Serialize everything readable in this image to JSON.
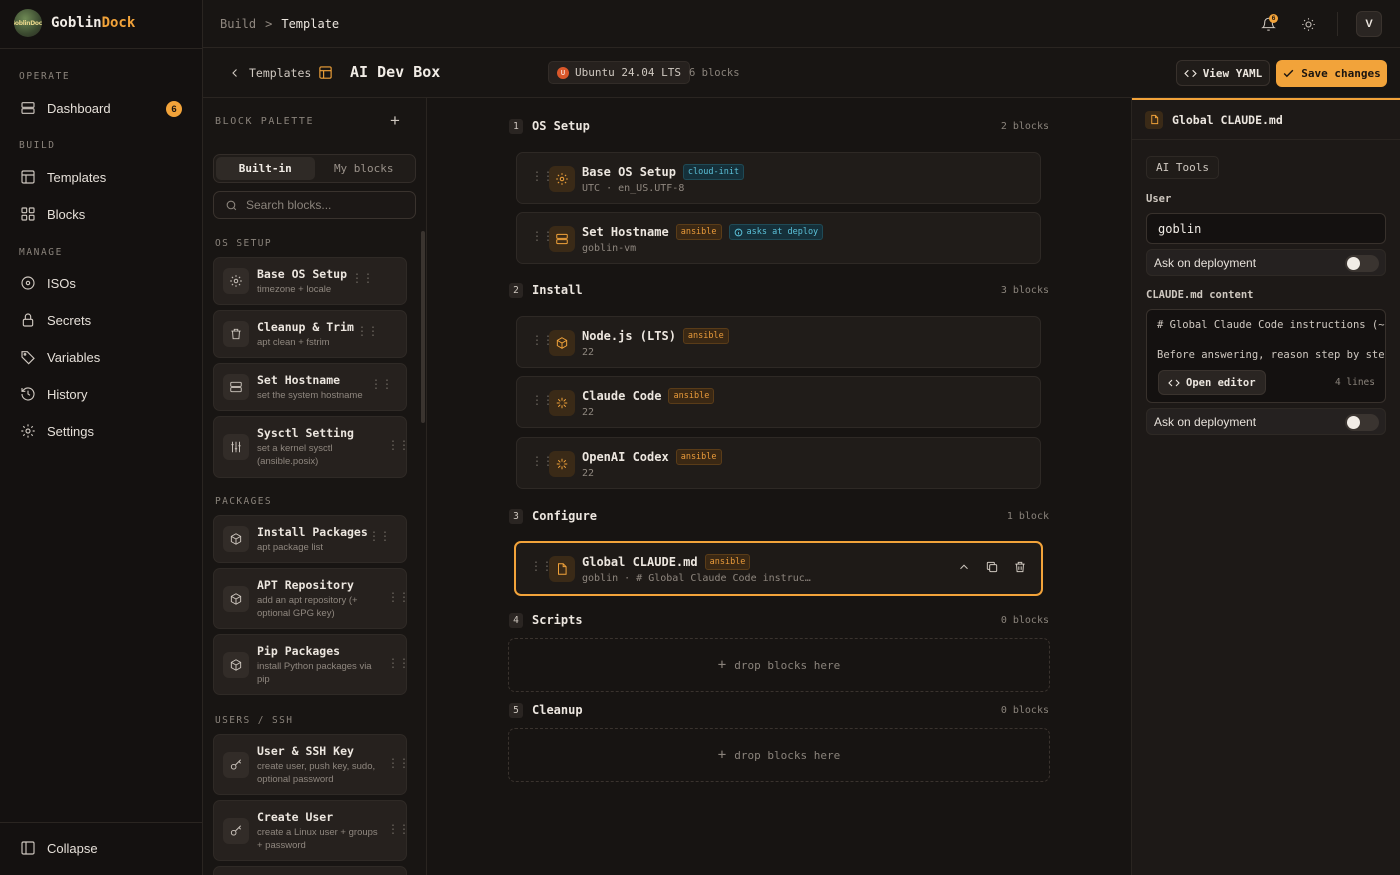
{
  "app": {
    "brand_part1": "Goblin",
    "brand_part2": "Dock",
    "logo_text": "GoblinDock"
  },
  "sidebar": {
    "sections": {
      "operate": "OPERATE",
      "build": "BUILD",
      "manage": "MANAGE"
    },
    "items": [
      {
        "label": "Dashboard",
        "icon": "server-icon",
        "badge": "6"
      },
      {
        "label": "Templates",
        "icon": "template-icon"
      },
      {
        "label": "Blocks",
        "icon": "grid-icon"
      },
      {
        "label": "ISOs",
        "icon": "disc-icon"
      },
      {
        "label": "Secrets",
        "icon": "lock-icon"
      },
      {
        "label": "Variables",
        "icon": "tag-icon"
      },
      {
        "label": "History",
        "icon": "history-icon"
      },
      {
        "label": "Settings",
        "icon": "gear-icon"
      }
    ],
    "collapse": "Collapse"
  },
  "topbar": {
    "breadcrumb": [
      "Build",
      "Template"
    ],
    "notifications": "6",
    "avatar": "V"
  },
  "titlebar": {
    "back": "Templates",
    "title": "AI Dev Box",
    "os": "Ubuntu 24.04 LTS",
    "os_badge": "U",
    "block_count": "6 blocks",
    "view_yaml": "View YAML",
    "save": "Save changes"
  },
  "palette": {
    "header": "BLOCK PALETTE",
    "tabs": [
      "Built-in",
      "My blocks"
    ],
    "search_placeholder": "Search blocks...",
    "categories": [
      "OS SETUP",
      "PACKAGES",
      "USERS / SSH"
    ],
    "cards": [
      {
        "name": "Base OS Setup",
        "desc": [
          "timezone + locale"
        ],
        "icon": "gear-icon"
      },
      {
        "name": "Cleanup & Trim",
        "desc": [
          "apt clean + fstrim"
        ],
        "icon": "trash-icon"
      },
      {
        "name": "Set Hostname",
        "desc": [
          "set the system hostname"
        ],
        "icon": "server-icon"
      },
      {
        "name": "Sysctl Setting",
        "desc": [
          "set a kernel sysctl",
          "(ansible.posix)"
        ],
        "icon": "sliders-icon"
      },
      {
        "name": "Install Packages",
        "desc": [
          "apt package list"
        ],
        "icon": "package-icon"
      },
      {
        "name": "APT Repository",
        "desc": [
          "add an apt repository (+",
          "optional GPG key)"
        ],
        "icon": "package-icon"
      },
      {
        "name": "Pip Packages",
        "desc": [
          "install Python packages via",
          "pip"
        ],
        "icon": "package-icon"
      },
      {
        "name": "User & SSH Key",
        "desc": [
          "create user, push key, sudo,",
          "optional password"
        ],
        "icon": "key-icon"
      },
      {
        "name": "Create User",
        "desc": [
          "create a Linux user + groups",
          "+ password"
        ],
        "icon": "key-icon"
      }
    ]
  },
  "canvas": {
    "sections": [
      {
        "num": "1",
        "title": "OS Setup",
        "count": "2 blocks"
      },
      {
        "num": "2",
        "title": "Install",
        "count": "3 blocks"
      },
      {
        "num": "3",
        "title": "Configure",
        "count": "1 block"
      },
      {
        "num": "4",
        "title": "Scripts",
        "count": "0 blocks"
      },
      {
        "num": "5",
        "title": "Cleanup",
        "count": "0 blocks"
      }
    ],
    "blocks": [
      {
        "name": "Base OS Setup",
        "tag": "cloud-init",
        "sub": "UTC · en_US.UTF-8",
        "icon": "gear-icon"
      },
      {
        "name": "Set Hostname",
        "tag": "ansible",
        "ask": "asks at deploy",
        "sub": "goblin-vm",
        "icon": "server-icon"
      },
      {
        "name": "Node.js (LTS)",
        "tag": "ansible",
        "sub": "22",
        "icon": "package-icon"
      },
      {
        "name": "Claude Code",
        "tag": "ansible",
        "sub": "22",
        "icon": "spark-icon"
      },
      {
        "name": "OpenAI Codex",
        "tag": "ansible",
        "sub": "22",
        "icon": "spark-icon"
      },
      {
        "name": "Global CLAUDE.md",
        "tag": "ansible",
        "sub": "goblin · # Global Claude Code instruc…",
        "icon": "file-icon"
      }
    ],
    "drop_text": "drop blocks here"
  },
  "inspector": {
    "title": "Global CLAUDE.md",
    "tab": "AI Tools",
    "user_label": "User",
    "user_value": "goblin",
    "ask_label": "Ask on deployment",
    "content_label": "CLAUDE.md content",
    "code_lines": [
      "# Global Claude Code instructions (~/.claude/CLAUDE.md)",
      "Before answering, reason step by step"
    ],
    "open_editor": "Open editor",
    "line_count": "4 lines"
  },
  "colors": {
    "accent": "#f2a33a",
    "background": "#171412",
    "cloud_init": "#5cc1d8"
  }
}
